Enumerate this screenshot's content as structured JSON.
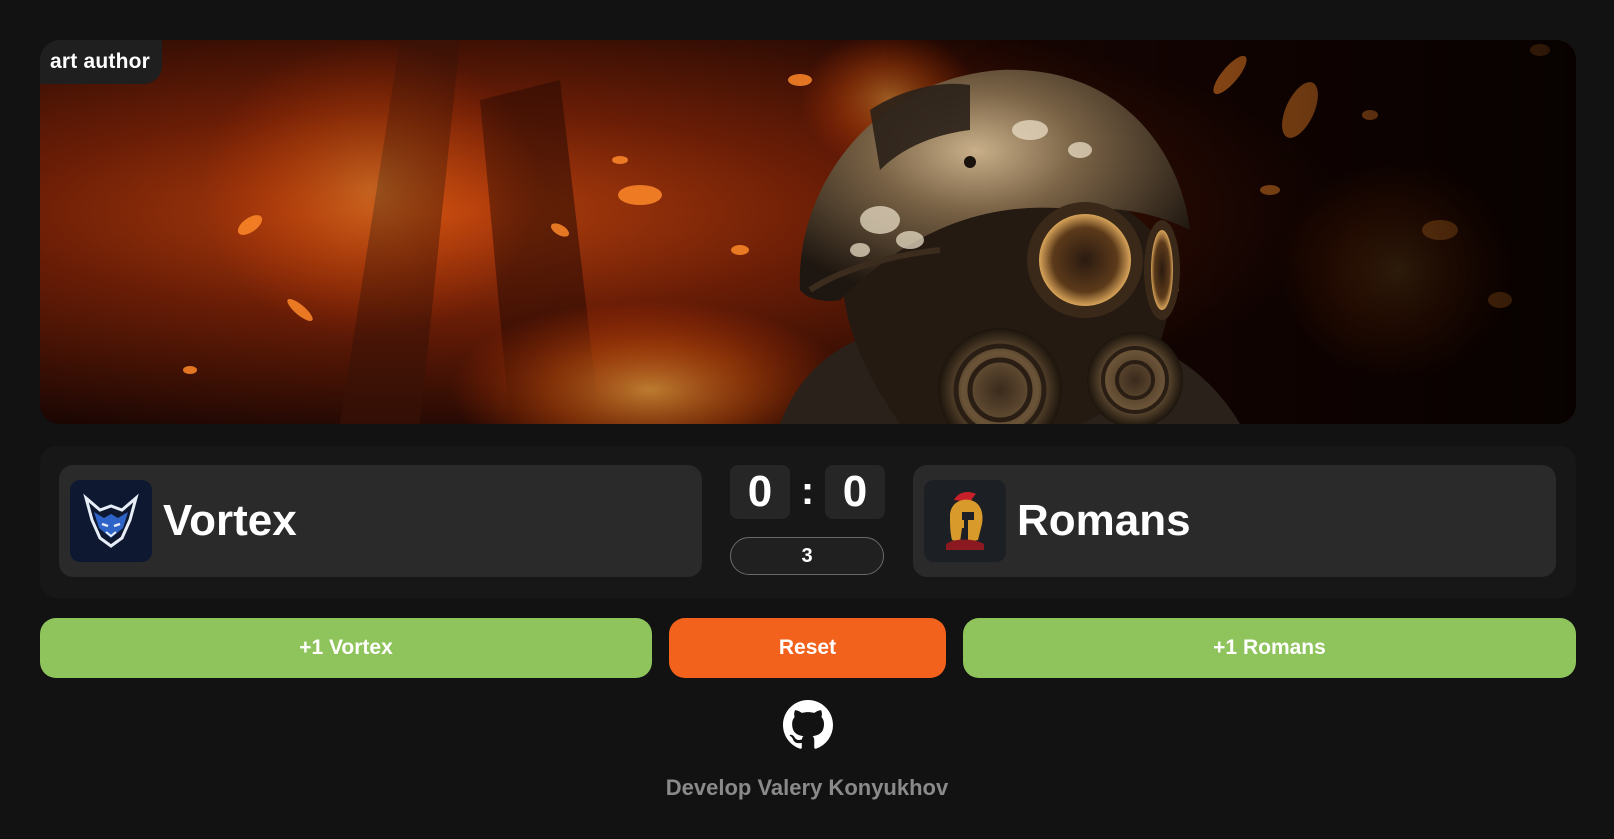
{
  "banner": {
    "credit_label": "art author"
  },
  "match": {
    "left_team": {
      "name": "Vortex",
      "logo_icon": "wolf-logo-icon"
    },
    "right_team": {
      "name": "Romans",
      "logo_icon": "spartan-helmet-logo-icon"
    },
    "score_left": "0",
    "score_separator": ":",
    "score_right": "0",
    "round": "3"
  },
  "controls": {
    "add_left_label": "+1 Vortex",
    "reset_label": "Reset",
    "add_right_label": "+1 Romans"
  },
  "footer": {
    "github_icon": "github-icon",
    "credit": "Develop Valery Konyukhov"
  },
  "colors": {
    "background": "#121212",
    "panel": "#171717",
    "card": "#2a2a2a",
    "add_button": "#8fc45c",
    "reset_button": "#f2621c",
    "footer_text": "#8a8a8a"
  }
}
